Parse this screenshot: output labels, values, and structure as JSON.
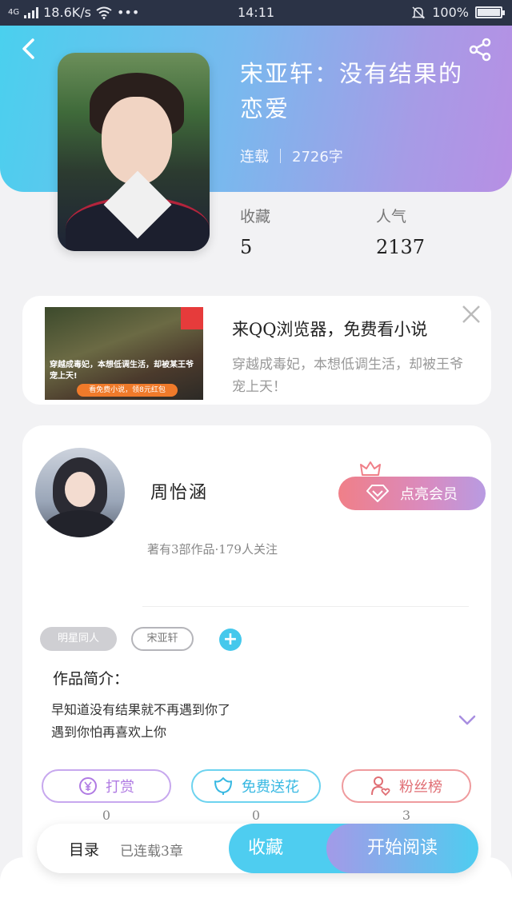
{
  "status_bar": {
    "network": "4G",
    "speed": "18.6K/s",
    "more": "•••",
    "time": "14:11",
    "battery": "100%"
  },
  "book": {
    "title": "宋亚轩：没有结果的恋爱",
    "status": "连载",
    "word_count": "2726字",
    "stats": [
      {
        "label": "收藏",
        "value": "5"
      },
      {
        "label": "人气",
        "value": "2137"
      }
    ]
  },
  "ad": {
    "headline": "来QQ浏览器，免费看小说",
    "description": "穿越成毒妃，本想低调生活，却被王爷宠上天！",
    "image_text": "穿越成毒妃，本想低调生活，却被某王爷宠上天!",
    "image_button": "看免费小说，领8元红包"
  },
  "author": {
    "name": "周怡涵",
    "stats": "著有3部作品·179人关注",
    "vip_label": "点亮会员"
  },
  "tags": [
    "明星同人",
    "宋亚轩"
  ],
  "intro": {
    "heading": "作品简介：",
    "lines": [
      "早知道没有结果就不再遇到你了",
      "遇到你怕再喜欢上你"
    ]
  },
  "actions": [
    {
      "label": "打赏",
      "icon": "yen-coin-icon",
      "count": "0",
      "color": "#b07be3"
    },
    {
      "label": "免费送花",
      "icon": "flower-icon",
      "count": "0",
      "color": "#37b8e2"
    },
    {
      "label": "粉丝榜",
      "icon": "fan-user-heart-icon",
      "count": "3",
      "color": "#e06e74"
    }
  ],
  "bottom_bar": {
    "catalog_label": "目录",
    "catalog_status": "已连载3章",
    "collect_label": "收藏",
    "read_label": "开始阅读"
  },
  "colors": {
    "header_gradient_start": "#4ad0ee",
    "header_gradient_end": "#b78fe4",
    "accent_blue": "#4ecdf0",
    "vip_pink": "#f07f88"
  }
}
